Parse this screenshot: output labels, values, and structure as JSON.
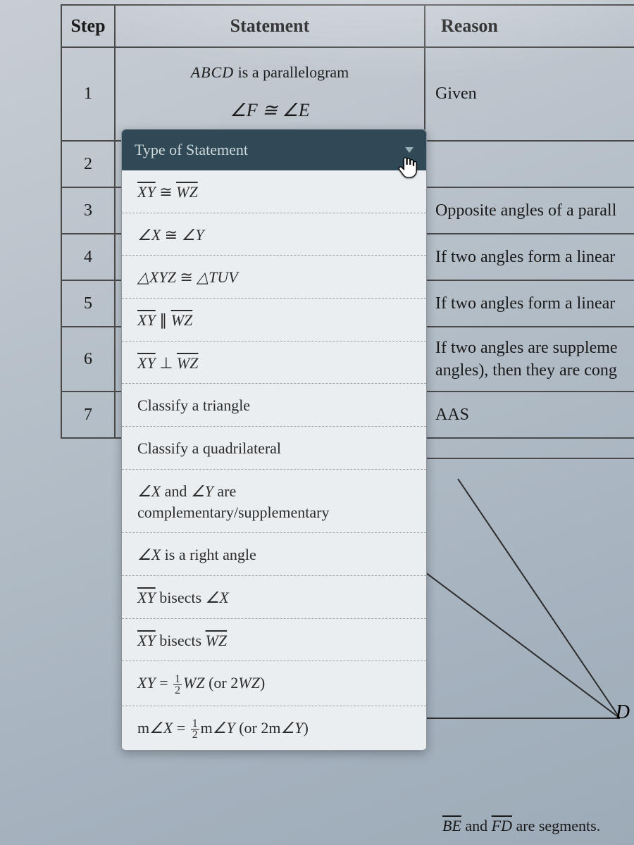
{
  "headers": {
    "step": "Step",
    "statement": "Statement",
    "reason": "Reason"
  },
  "rows": [
    {
      "step": "1",
      "statement_line1": "ABCD is a parallelogram",
      "statement_line2": "∠F ≅ ∠E",
      "reason": "Given"
    },
    {
      "step": "2",
      "statement": "",
      "reason": ""
    },
    {
      "step": "3",
      "statement": "",
      "reason": "Opposite angles of a parall"
    },
    {
      "step": "4",
      "statement": "",
      "reason": "If two angles form a linear"
    },
    {
      "step": "5",
      "statement": "",
      "reason": "If two angles form a linear"
    },
    {
      "step": "6",
      "statement": "",
      "reason": "If two angles are suppleme\nangles), then they are cong"
    },
    {
      "step": "7",
      "statement": "",
      "reason": "AAS"
    }
  ],
  "dropdown": {
    "placeholder": "Type of Statement",
    "options": [
      "X̅Y̅ ≅ W̅Z̅",
      "∠X ≅ ∠Y",
      "△XYZ ≅ △TUV",
      "X̅Y̅ ∥ W̅Z̅",
      "X̅Y̅ ⊥ W̅Z̅",
      "Classify a triangle",
      "Classify a quadrilateral",
      "∠X and ∠Y are complementary/supplementary",
      "∠X is a right angle",
      "X̅Y̅ bisects ∠X",
      "X̅Y̅ bisects W̅Z̅",
      "XY = ½WZ (or 2WZ)",
      "m∠X = ½m∠Y (or 2m∠Y)"
    ]
  },
  "figure": {
    "label_D": "D"
  },
  "bottom_note_prefix": "B̅E̅ and F̅D̅",
  "bottom_note_suffix": " are segments."
}
